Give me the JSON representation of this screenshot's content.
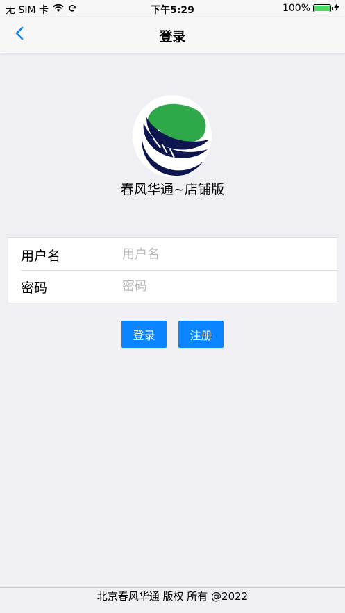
{
  "status_bar": {
    "carrier": "无 SIM 卡",
    "time": "下午5:29",
    "battery": "100%",
    "battery_level": 1.0,
    "wifi_icon": "wifi-icon",
    "sync_icon": "sync-icon",
    "charging_icon": "charging-icon"
  },
  "nav": {
    "title": "登录",
    "back_icon": "chevron-left-icon"
  },
  "app": {
    "name": "春风华通~店铺版",
    "logo_colors": {
      "green": "#2fa84a",
      "navy": "#0e1650"
    }
  },
  "form": {
    "username_label": "用户名",
    "username_placeholder": "用户名",
    "username_value": "",
    "password_label": "密码",
    "password_placeholder": "密码",
    "password_value": ""
  },
  "buttons": {
    "login": "登录",
    "register": "注册"
  },
  "footer": {
    "text": "北京春风华通 版权 所有 @2022"
  },
  "colors": {
    "accent": "#0a84ff",
    "background": "#efeff4"
  }
}
